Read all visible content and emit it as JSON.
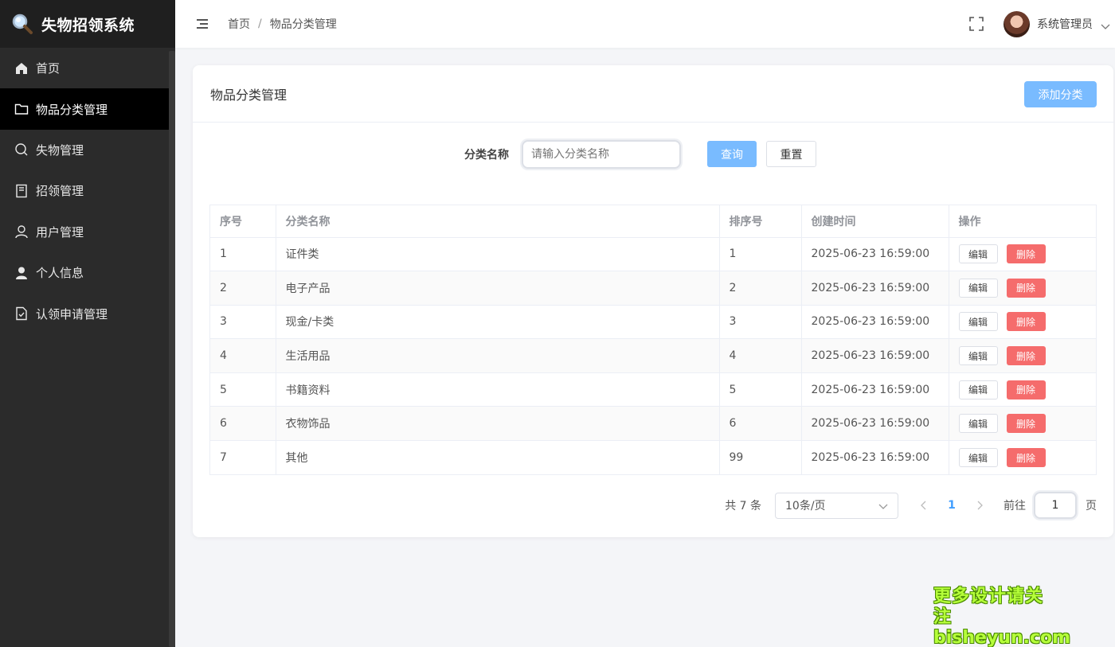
{
  "app": {
    "title": "失物招领系统"
  },
  "sidebar": {
    "items": [
      {
        "label": "首页",
        "icon": "home-icon",
        "active": false
      },
      {
        "label": "物品分类管理",
        "icon": "folder-icon",
        "active": true
      },
      {
        "label": "失物管理",
        "icon": "search-icon",
        "active": false
      },
      {
        "label": "招领管理",
        "icon": "notebook-icon",
        "active": false
      },
      {
        "label": "用户管理",
        "icon": "user-icon",
        "active": false
      },
      {
        "label": "个人信息",
        "icon": "user-filled-icon",
        "active": false
      },
      {
        "label": "认领申请管理",
        "icon": "document-check-icon",
        "active": false
      }
    ]
  },
  "header": {
    "breadcrumb": [
      "首页",
      "物品分类管理"
    ],
    "breadcrumb_sep": "/",
    "user_name": "系统管理员"
  },
  "card": {
    "title": "物品分类管理",
    "add_label": "添加分类"
  },
  "search": {
    "label": "分类名称",
    "placeholder": "请输入分类名称",
    "query_label": "查询",
    "reset_label": "重置"
  },
  "table": {
    "columns": [
      "序号",
      "分类名称",
      "排序号",
      "创建时间",
      "操作"
    ],
    "edit_label": "编辑",
    "delete_label": "删除",
    "rows": [
      {
        "index": "1",
        "name": "证件类",
        "sort": "1",
        "created": "2025-06-23 16:59:00"
      },
      {
        "index": "2",
        "name": "电子产品",
        "sort": "2",
        "created": "2025-06-23 16:59:00"
      },
      {
        "index": "3",
        "name": "现金/卡类",
        "sort": "3",
        "created": "2025-06-23 16:59:00"
      },
      {
        "index": "4",
        "name": "生活用品",
        "sort": "4",
        "created": "2025-06-23 16:59:00"
      },
      {
        "index": "5",
        "name": "书籍资料",
        "sort": "5",
        "created": "2025-06-23 16:59:00"
      },
      {
        "index": "6",
        "name": "衣物饰品",
        "sort": "6",
        "created": "2025-06-23 16:59:00"
      },
      {
        "index": "7",
        "name": "其他",
        "sort": "99",
        "created": "2025-06-23 16:59:00"
      }
    ]
  },
  "pagination": {
    "total_text": "共 7 条",
    "page_size": "10条/页",
    "current_page": "1",
    "goto_label": "前往",
    "goto_value": "1",
    "page_unit": "页"
  },
  "watermark": {
    "line1": "更多设计请关注",
    "line2": "bisheyun.com"
  },
  "colors": {
    "primary_light": "#79bbff",
    "danger": "#f56c6c",
    "sidebar_bg": "#2b2b2b",
    "active_bg": "#000000"
  }
}
